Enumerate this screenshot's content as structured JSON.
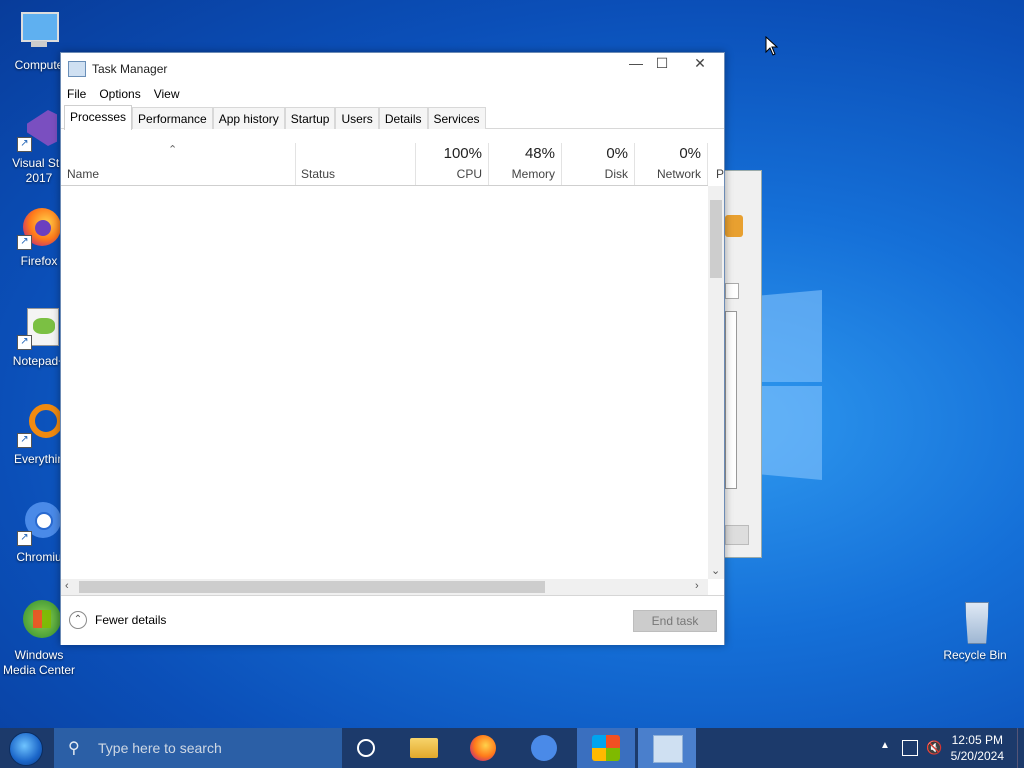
{
  "desktop": {
    "icons": [
      {
        "label": "Compute"
      },
      {
        "label": "Visual Stu 2017"
      },
      {
        "label": "Firefox"
      },
      {
        "label": "Notepad+"
      },
      {
        "label": "Everythin"
      },
      {
        "label": "Chromiu"
      },
      {
        "label": "Windows Media Center"
      }
    ],
    "recycle_bin": "Recycle Bin"
  },
  "task_manager": {
    "title": "Task Manager",
    "menu": [
      "File",
      "Options",
      "View"
    ],
    "tabs": [
      "Processes",
      "Performance",
      "App history",
      "Startup",
      "Users",
      "Details",
      "Services"
    ],
    "active_tab": "Processes",
    "columns": {
      "name": "Name",
      "status": "Status",
      "cpu": {
        "label": "CPU",
        "value": "100%"
      },
      "memory": {
        "label": "Memory",
        "value": "48%"
      },
      "disk": {
        "label": "Disk",
        "value": "0%"
      },
      "network": {
        "label": "Network",
        "value": "0%"
      },
      "power": "P"
    },
    "fewer_details": "Fewer details",
    "end_task": "End task"
  },
  "taskbar": {
    "search_placeholder": "Type here to search",
    "time": "12:05 PM",
    "date": "5/20/2024"
  }
}
